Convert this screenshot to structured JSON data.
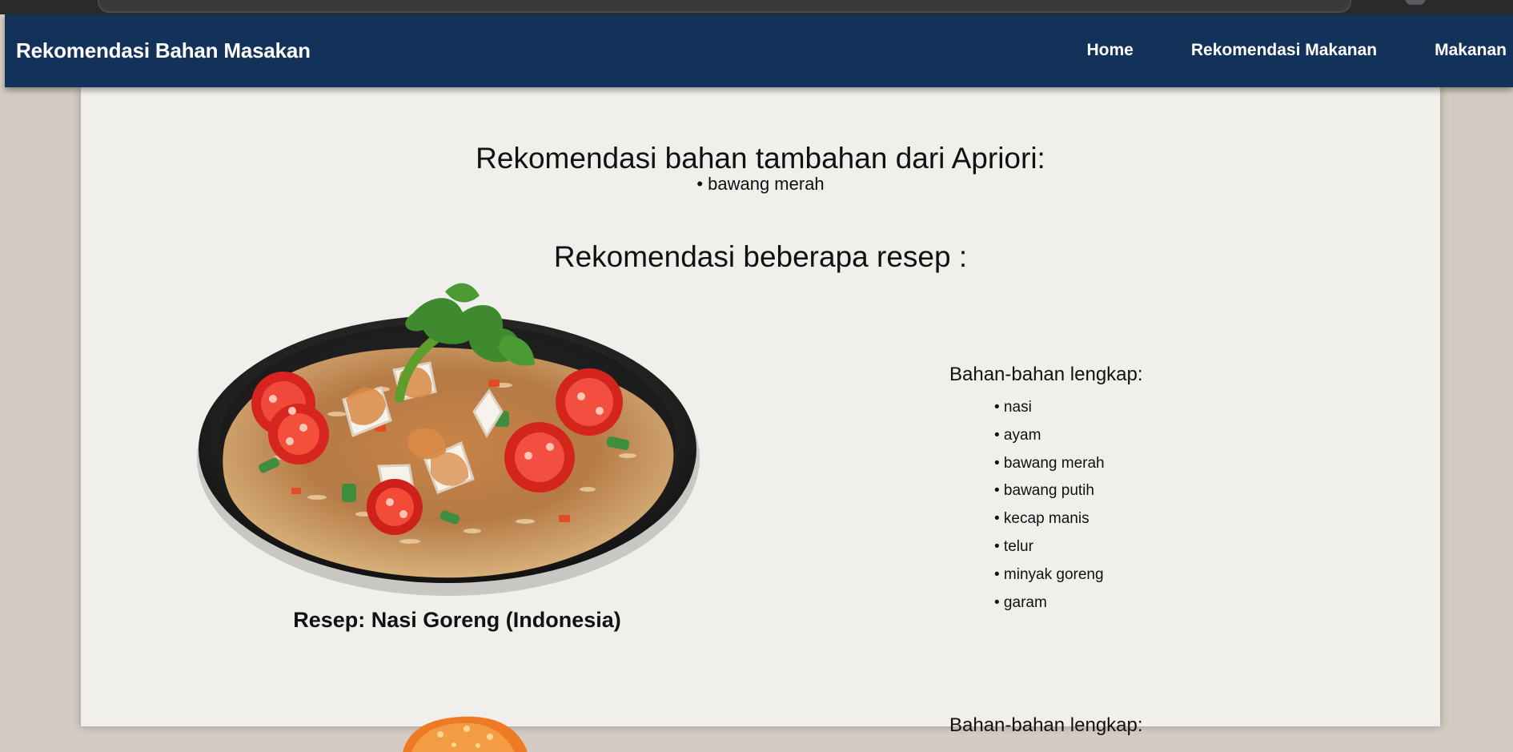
{
  "navbar": {
    "brand": "Rekomendasi Bahan Masakan",
    "links": [
      "Home",
      "Rekomendasi Makanan",
      "Makanan"
    ]
  },
  "apriori": {
    "title": "Rekomendasi bahan tambahan dari Apriori:",
    "items": [
      "• bawang merah"
    ]
  },
  "recipes": {
    "title": "Rekomendasi beberapa resep :",
    "items": [
      {
        "name": "Resep: Nasi Goreng (Indonesia)",
        "ingredients_title": "Bahan-bahan lengkap:",
        "ingredients": [
          "• nasi",
          "• ayam",
          "• bawang merah",
          "• bawang putih",
          "• kecap manis",
          "• telur",
          "• minyak goreng",
          "• garam"
        ]
      },
      {
        "ingredients_title": "Bahan-bahan lengkap:"
      }
    ]
  },
  "colors": {
    "navbar": "#13325a",
    "content_background": "#f1efec",
    "page_background": "#d4ccc2"
  },
  "icons": [
    "browser-address-bar",
    "dish-image-nasi-goreng",
    "dish-image-second"
  ]
}
